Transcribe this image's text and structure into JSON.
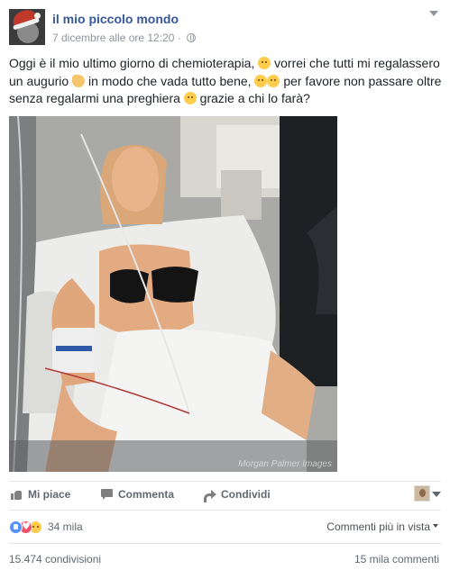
{
  "post": {
    "author": "il mio piccolo mondo",
    "timestamp": "7 dicembre alle ore 12:20",
    "separator": "·",
    "audience_icon": "globe-icon",
    "menu_icon": "chevron-down-icon",
    "text": {
      "part1": "Oggi è il mio ultimo giorno di chemioterapia,",
      "part2": "vorrei che tutti mi regalassero un augurio",
      "part3": "in modo che vada tutto bene,",
      "part4": "per favore non passare oltre senza regalarmi una preghiera",
      "part5": "grazie a chi lo farà?"
    },
    "photo_watermark": "Morgan Palmer Images"
  },
  "actions": {
    "like_label": "Mi piace",
    "comment_label": "Commenta",
    "share_label": "Condividi"
  },
  "reactions": {
    "count": "34 mila",
    "sort_label": "Commenti più in vista"
  },
  "stats": {
    "shares": "15.474 condivisioni",
    "comments": "15 mila commenti"
  },
  "colors": {
    "link_blue": "#365899",
    "meta_gray": "#90949c",
    "like_blue": "#5890ff",
    "love_red": "#f25268"
  }
}
